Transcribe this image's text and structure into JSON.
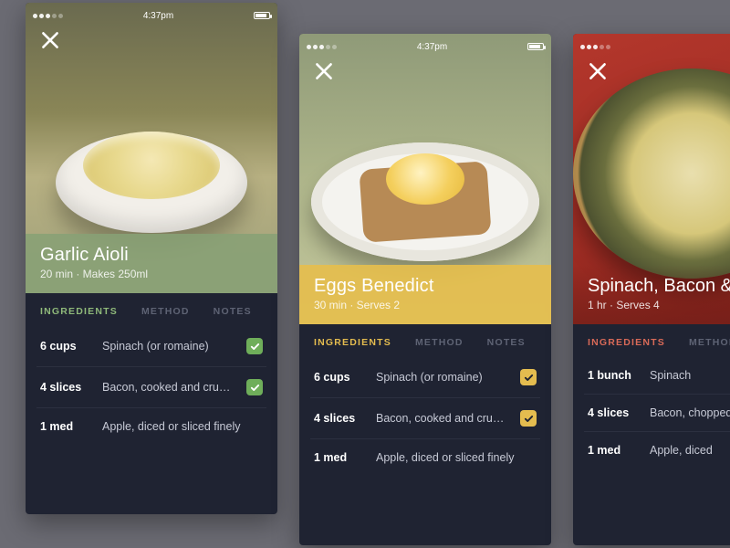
{
  "status": {
    "time": "4:37pm"
  },
  "tabs": {
    "ingredients": "INGREDIENTS",
    "method": "METHOD",
    "notes": "NOTES"
  },
  "cards": [
    {
      "accent": "green",
      "name": "Garlic Aioli",
      "meta": "20 min · Makes 250ml",
      "ingredients": [
        {
          "qty": "6 cups",
          "name": "Spinach (or romaine)",
          "checked": true
        },
        {
          "qty": "4 slices",
          "name": "Bacon, cooked and crumbled",
          "checked": true
        },
        {
          "qty": "1 med",
          "name": "Apple, diced or sliced finely",
          "checked": false
        }
      ]
    },
    {
      "accent": "yellow",
      "name": "Eggs Benedict",
      "meta": "30 min · Serves 2",
      "ingredients": [
        {
          "qty": "6 cups",
          "name": "Spinach (or romaine)",
          "checked": true
        },
        {
          "qty": "4 slices",
          "name": "Bacon, cooked and crumbled",
          "checked": true
        },
        {
          "qty": "1 med",
          "name": "Apple, diced or sliced finely",
          "checked": false
        }
      ]
    },
    {
      "accent": "red",
      "name": "Spinach, Bacon & …",
      "meta": "1 hr · Serves 4",
      "ingredients": [
        {
          "qty": "1 bunch",
          "name": "Spinach",
          "checked": false
        },
        {
          "qty": "4 slices",
          "name": "Bacon, chopped",
          "checked": false
        },
        {
          "qty": "1 med",
          "name": "Apple, diced",
          "checked": false
        }
      ]
    }
  ]
}
